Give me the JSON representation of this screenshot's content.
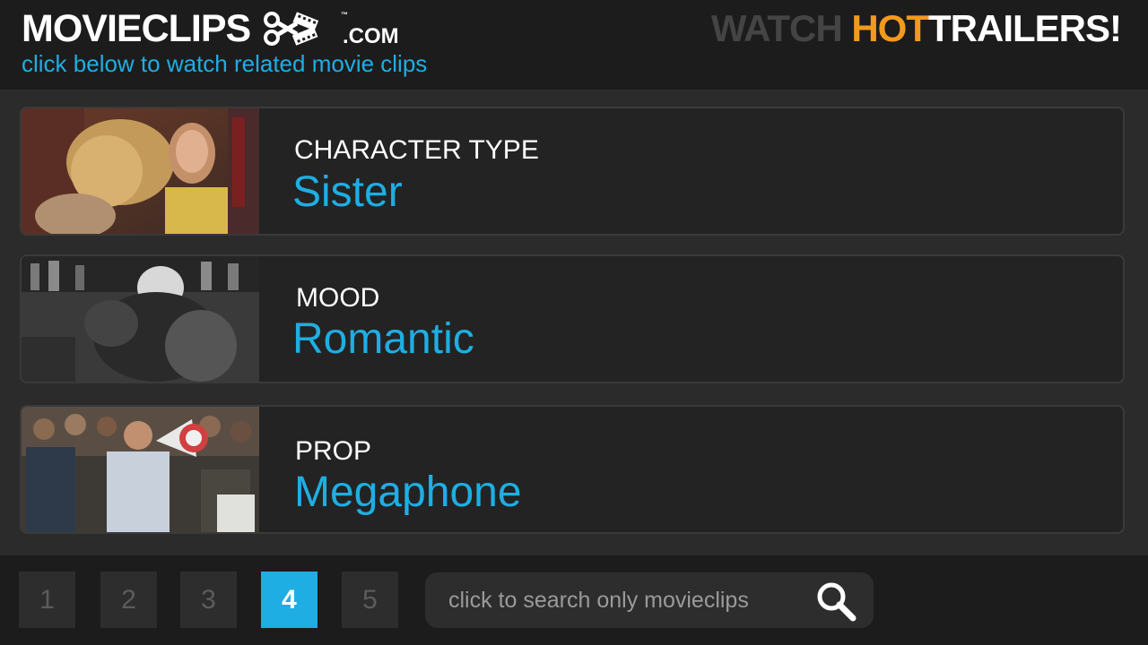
{
  "header": {
    "logo_text": "MOVIECLIPS",
    "logo_tm": "™",
    "logo_com": ".COM",
    "subtitle": "click below to watch related movie clips",
    "promo_watch": "WATCH ",
    "promo_hot": "HOT",
    "promo_trailers": "TRAILERS!"
  },
  "cards": [
    {
      "label": "CHARACTER TYPE",
      "value": "Sister"
    },
    {
      "label": "MOOD",
      "value": "Romantic"
    },
    {
      "label": "PROP",
      "value": "Megaphone"
    }
  ],
  "pagination": {
    "pages": [
      "1",
      "2",
      "3",
      "4",
      "5"
    ],
    "active_page": "4"
  },
  "search": {
    "placeholder": "click to search only movieclips",
    "icon": "search-icon"
  },
  "colors": {
    "accent": "#1eaee3",
    "hot": "#f29a1e",
    "background": "#2b2b2b",
    "bar": "#1c1c1c"
  }
}
